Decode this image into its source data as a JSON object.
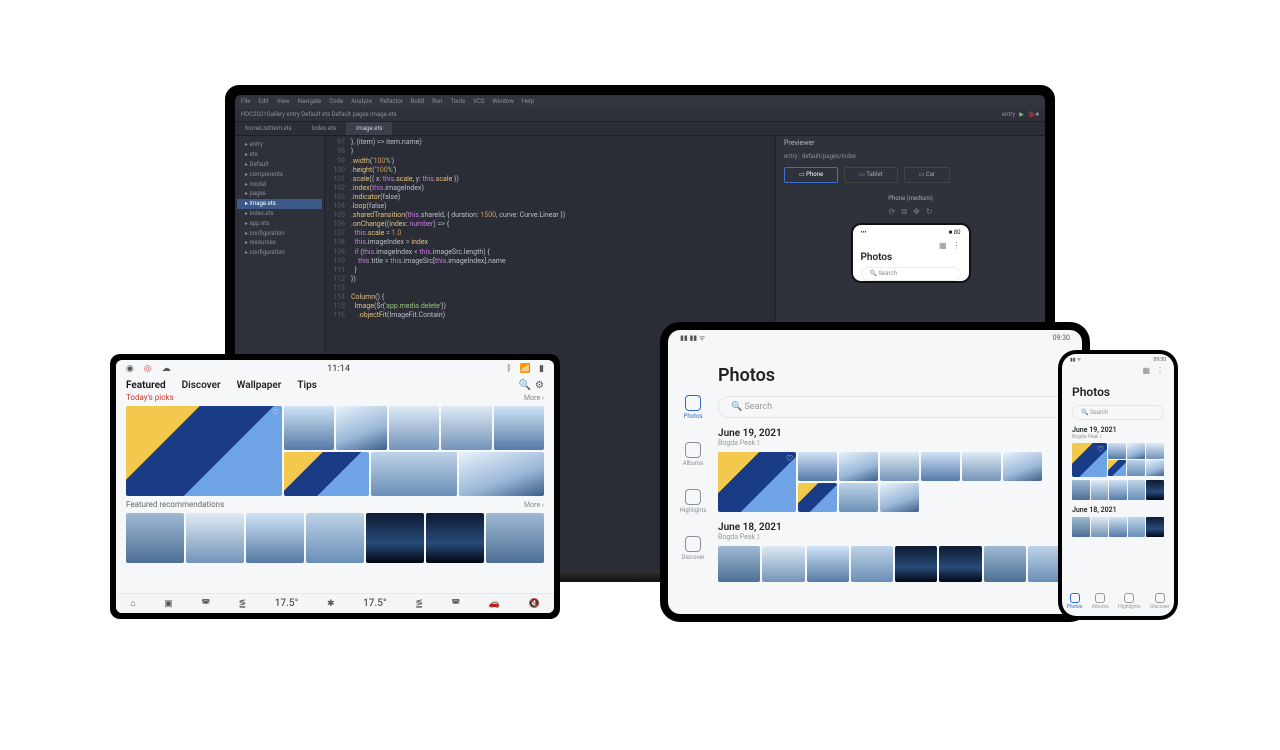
{
  "ide": {
    "menu": [
      "File",
      "Edit",
      "View",
      "Navigate",
      "Code",
      "Analyze",
      "Refactor",
      "Build",
      "Run",
      "Tools",
      "VCS",
      "Window",
      "Help"
    ],
    "breadcrumb": "HDC2021Gallery   entry   Default   ets   Default   pages   image.ets",
    "runTarget": "entry",
    "tabs": [
      "homeListItem.ets",
      "Index.ets",
      "image.ets"
    ],
    "active_tab": 2,
    "tree": [
      "entry",
      "ets",
      "Default",
      "components",
      "model",
      "pages",
      "image.ets",
      "index.ets",
      "app.ets",
      "configuration",
      "resources",
      "configuration"
    ],
    "tree_sel": 6,
    "code_start": 97,
    "code": [
      "}, (item) => item.name)",
      "}",
      ".width('100%')",
      ".height('100%')",
      ".scale({ x: this.scale, y: this.scale })",
      ".index(this.imageIndex)",
      ".indicator(false)",
      ".loop(false)",
      ".sharedTransition(this.shareId, { duration: 1500, curve: Curve.Linear })",
      ".onChange((index: number) => {",
      "  this.scale = 1.0",
      "  this.imageIndex = index",
      "  if (this.imageIndex < this.imageSrc.length) {",
      "    this.title = this.imageSrc[this.imageIndex].name",
      "  }",
      "})",
      "",
      "Column() {",
      "  Image($r('app.media.delete'))",
      "    .objectFit(ImageFit.Contain)"
    ],
    "preview_title": "Previewer",
    "preview_path": "entry : default/pages/index",
    "preview_buttons": [
      "Phone",
      "Tablet",
      "Car"
    ],
    "preview_device": "Phone (medium)"
  },
  "car": {
    "time": "11:14",
    "tabs": [
      "Featured",
      "Discover",
      "Wallpaper",
      "Tips"
    ],
    "active_tab": 0,
    "section1": "Today's picks",
    "section2": "Featured recommendations",
    "more": "More",
    "temps": [
      "17.5°",
      "17.5°"
    ]
  },
  "tablet": {
    "time": "09:30",
    "title": "Photos",
    "search_placeholder": "Search",
    "sidebar": [
      "Photos",
      "Albums",
      "Highlights",
      "Discover"
    ],
    "sidebar_active": 0,
    "groups": [
      {
        "date": "June 19, 2021",
        "loc": "Bogda Peak"
      },
      {
        "date": "June 18, 2021",
        "loc": "Bogda Peak"
      }
    ]
  },
  "phone": {
    "time": "09:30",
    "title": "Photos",
    "search_placeholder": "Search",
    "groups": [
      {
        "date": "June 19, 2021",
        "loc": "Bogda Peak"
      },
      {
        "date": "June 18, 2021"
      }
    ],
    "nav": [
      "Photos",
      "Albums",
      "Highlights",
      "Discover"
    ],
    "nav_active": 0
  },
  "preview_app": {
    "title": "Photos",
    "search": "Search"
  }
}
